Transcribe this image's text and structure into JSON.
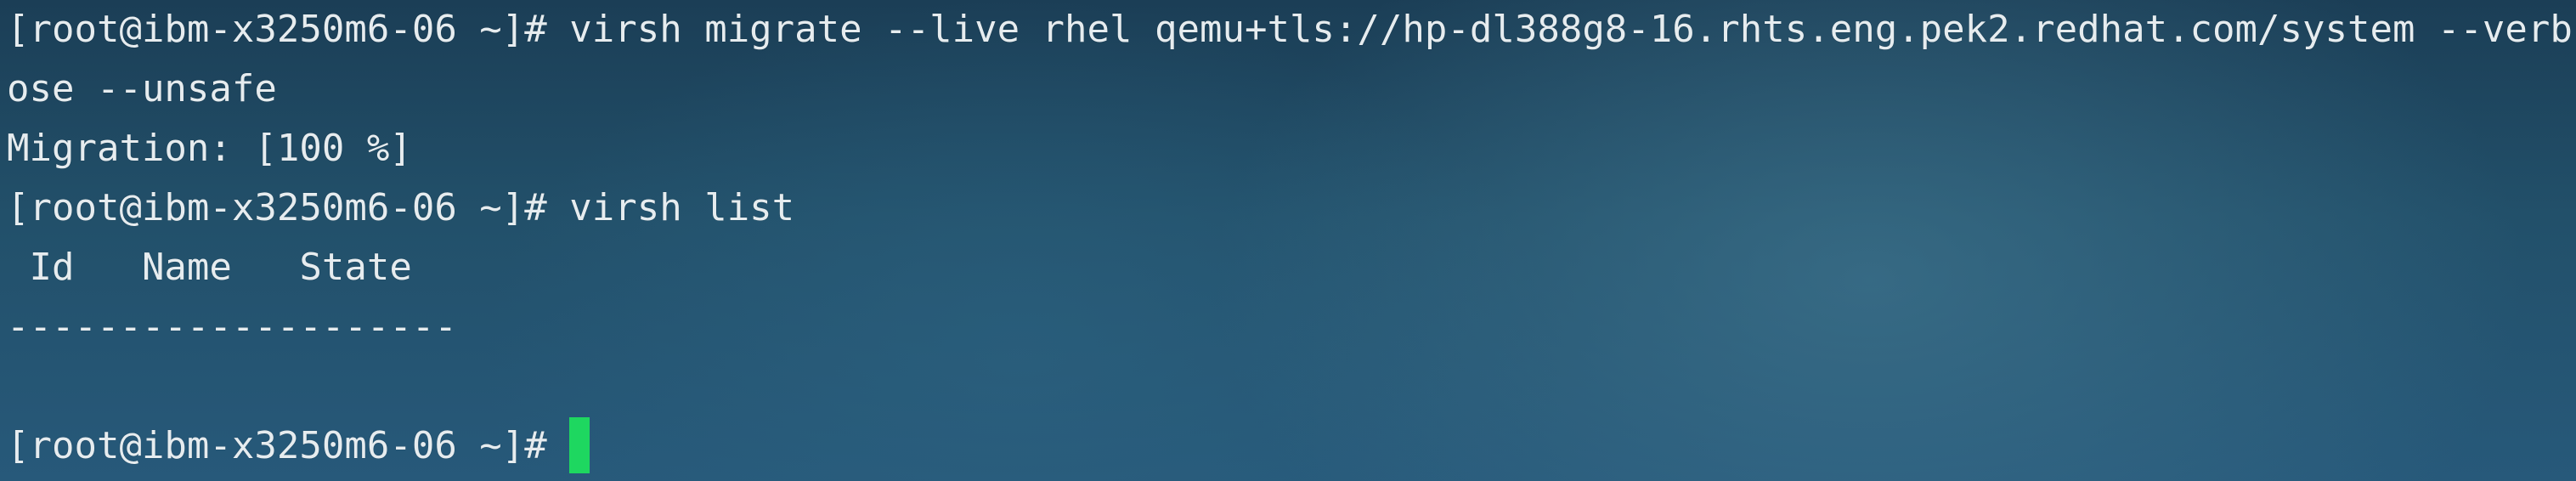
{
  "terminal": {
    "lines": [
      "[root@ibm-x3250m6-06 ~]# virsh migrate --live rhel qemu+tls://hp-dl388g8-16.rhts.eng.pek2.redhat.com/system --verb",
      "ose --unsafe",
      "Migration: [100 %]",
      "[root@ibm-x3250m6-06 ~]# virsh list",
      " Id   Name   State",
      "--------------------",
      ""
    ],
    "prompt": "[root@ibm-x3250m6-06 ~]# "
  },
  "colors": {
    "background": "#22506a",
    "text": "#e6ecef",
    "cursor": "#1ed760"
  }
}
